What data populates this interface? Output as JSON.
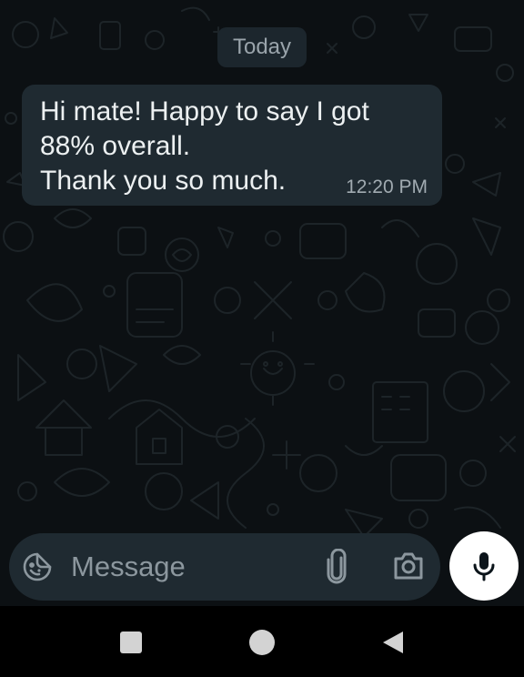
{
  "conversation": {
    "date_label": "Today",
    "messages": [
      {
        "lines": [
          "Hi mate! Happy to say I got",
          "88% overall.",
          "Thank you so much."
        ],
        "time": "12:20 PM",
        "direction": "incoming"
      }
    ]
  },
  "composer": {
    "placeholder": "Message",
    "emoji_icon": "sticker-icon",
    "attach_icon": "paperclip-icon",
    "camera_icon": "camera-icon",
    "mic_icon": "microphone-icon"
  },
  "navigation": {
    "recents_icon": "square-icon",
    "home_icon": "circle-icon",
    "back_icon": "triangle-back-icon"
  },
  "colors": {
    "background": "#0c1013",
    "bubble": "#1f2a31",
    "text": "#ecf0f1",
    "muted": "#8c979e",
    "mic_button": "#ffffff"
  }
}
